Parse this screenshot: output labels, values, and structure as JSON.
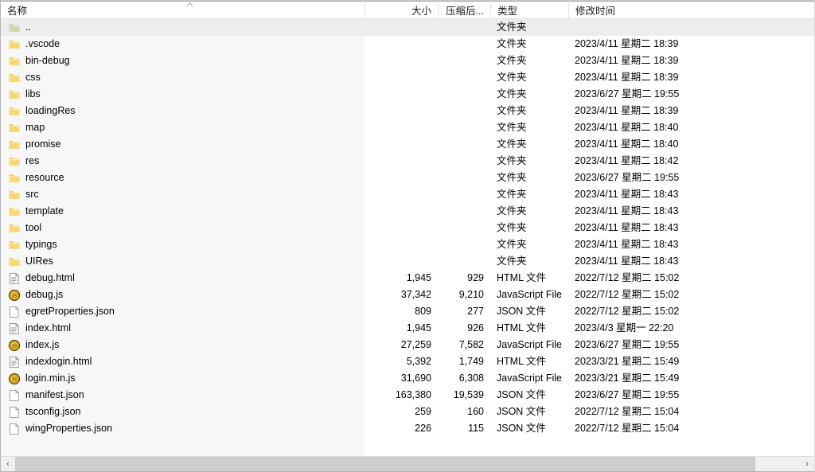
{
  "window": {
    "kind": "file-manager-list-view"
  },
  "columns": [
    {
      "key": "name",
      "label": "名称",
      "align": "left",
      "sorted": true,
      "sort_direction": "ascending"
    },
    {
      "key": "size",
      "label": "大小",
      "align": "right",
      "sorted": false
    },
    {
      "key": "packed",
      "label": "压缩后...",
      "align": "right",
      "sorted": false
    },
    {
      "key": "type",
      "label": "类型",
      "align": "left",
      "sorted": false
    },
    {
      "key": "modified",
      "label": "修改时间",
      "align": "left",
      "sorted": false
    }
  ],
  "types": {
    "folder": "文件夹",
    "html": "HTML 文件",
    "javascript": "JavaScript File",
    "json": "JSON 文件"
  },
  "rows": [
    {
      "name": "..",
      "icon": "parent-folder-icon",
      "size": "",
      "packed": "",
      "type": "文件夹",
      "modified": "",
      "selected": true
    },
    {
      "name": ".vscode",
      "icon": "folder-icon",
      "size": "",
      "packed": "",
      "type": "文件夹",
      "modified": "2023/4/11 星期二 18:39",
      "selected": false
    },
    {
      "name": "bin-debug",
      "icon": "folder-icon",
      "size": "",
      "packed": "",
      "type": "文件夹",
      "modified": "2023/4/11 星期二 18:39",
      "selected": false
    },
    {
      "name": "css",
      "icon": "folder-icon",
      "size": "",
      "packed": "",
      "type": "文件夹",
      "modified": "2023/4/11 星期二 18:39",
      "selected": false
    },
    {
      "name": "libs",
      "icon": "folder-icon",
      "size": "",
      "packed": "",
      "type": "文件夹",
      "modified": "2023/6/27 星期二 19:55",
      "selected": false
    },
    {
      "name": "loadingRes",
      "icon": "folder-icon",
      "size": "",
      "packed": "",
      "type": "文件夹",
      "modified": "2023/4/11 星期二 18:39",
      "selected": false
    },
    {
      "name": "map",
      "icon": "folder-icon",
      "size": "",
      "packed": "",
      "type": "文件夹",
      "modified": "2023/4/11 星期二 18:40",
      "selected": false
    },
    {
      "name": "promise",
      "icon": "folder-icon",
      "size": "",
      "packed": "",
      "type": "文件夹",
      "modified": "2023/4/11 星期二 18:40",
      "selected": false
    },
    {
      "name": "res",
      "icon": "folder-icon",
      "size": "",
      "packed": "",
      "type": "文件夹",
      "modified": "2023/4/11 星期二 18:42",
      "selected": false
    },
    {
      "name": "resource",
      "icon": "folder-icon",
      "size": "",
      "packed": "",
      "type": "文件夹",
      "modified": "2023/6/27 星期二 19:55",
      "selected": false
    },
    {
      "name": "src",
      "icon": "folder-icon",
      "size": "",
      "packed": "",
      "type": "文件夹",
      "modified": "2023/4/11 星期二 18:43",
      "selected": false
    },
    {
      "name": "template",
      "icon": "folder-icon",
      "size": "",
      "packed": "",
      "type": "文件夹",
      "modified": "2023/4/11 星期二 18:43",
      "selected": false
    },
    {
      "name": "tool",
      "icon": "folder-icon",
      "size": "",
      "packed": "",
      "type": "文件夹",
      "modified": "2023/4/11 星期二 18:43",
      "selected": false
    },
    {
      "name": "typings",
      "icon": "folder-icon",
      "size": "",
      "packed": "",
      "type": "文件夹",
      "modified": "2023/4/11 星期二 18:43",
      "selected": false
    },
    {
      "name": "UIRes",
      "icon": "folder-icon",
      "size": "",
      "packed": "",
      "type": "文件夹",
      "modified": "2023/4/11 星期二 18:43",
      "selected": false
    },
    {
      "name": "debug.html",
      "icon": "html-file-icon",
      "size": "1,945",
      "packed": "929",
      "type": "HTML 文件",
      "modified": "2022/7/12 星期二 15:02",
      "selected": false
    },
    {
      "name": "debug.js",
      "icon": "javascript-file-icon",
      "size": "37,342",
      "packed": "9,210",
      "type": "JavaScript File",
      "modified": "2022/7/12 星期二 15:02",
      "selected": false
    },
    {
      "name": "egretProperties.json",
      "icon": "blank-file-icon",
      "size": "809",
      "packed": "277",
      "type": "JSON 文件",
      "modified": "2022/7/12 星期二 15:02",
      "selected": false
    },
    {
      "name": "index.html",
      "icon": "html-file-icon",
      "size": "1,945",
      "packed": "926",
      "type": "HTML 文件",
      "modified": "2023/4/3 星期一 22:20",
      "selected": false
    },
    {
      "name": "index.js",
      "icon": "javascript-file-icon",
      "size": "27,259",
      "packed": "7,582",
      "type": "JavaScript File",
      "modified": "2023/6/27 星期二 19:55",
      "selected": false
    },
    {
      "name": "indexlogin.html",
      "icon": "html-file-icon",
      "size": "5,392",
      "packed": "1,749",
      "type": "HTML 文件",
      "modified": "2023/3/21 星期二 15:49",
      "selected": false
    },
    {
      "name": "login.min.js",
      "icon": "javascript-file-icon",
      "size": "31,690",
      "packed": "6,308",
      "type": "JavaScript File",
      "modified": "2023/3/21 星期二 15:49",
      "selected": false
    },
    {
      "name": "manifest.json",
      "icon": "blank-file-icon",
      "size": "163,380",
      "packed": "19,539",
      "type": "JSON 文件",
      "modified": "2023/6/27 星期二 19:55",
      "selected": false
    },
    {
      "name": "tsconfig.json",
      "icon": "blank-file-icon",
      "size": "259",
      "packed": "160",
      "type": "JSON 文件",
      "modified": "2022/7/12 星期二 15:04",
      "selected": false
    },
    {
      "name": "wingProperties.json",
      "icon": "blank-file-icon",
      "size": "226",
      "packed": "115",
      "type": "JSON 文件",
      "modified": "2022/7/12 星期二 15:04",
      "selected": false
    }
  ],
  "scrollbar": {
    "left_arrow": "‹",
    "right_arrow": "›",
    "thumb_fraction": 0.943
  },
  "colors": {
    "selected_row": "#ededed",
    "sorted_column": "#f7f7f7",
    "folder": "#f8d775",
    "parent_folder": "#c6d2a8",
    "javascript_icon": "#b58b12",
    "scrollbar_thumb": "#cdcdcd"
  }
}
